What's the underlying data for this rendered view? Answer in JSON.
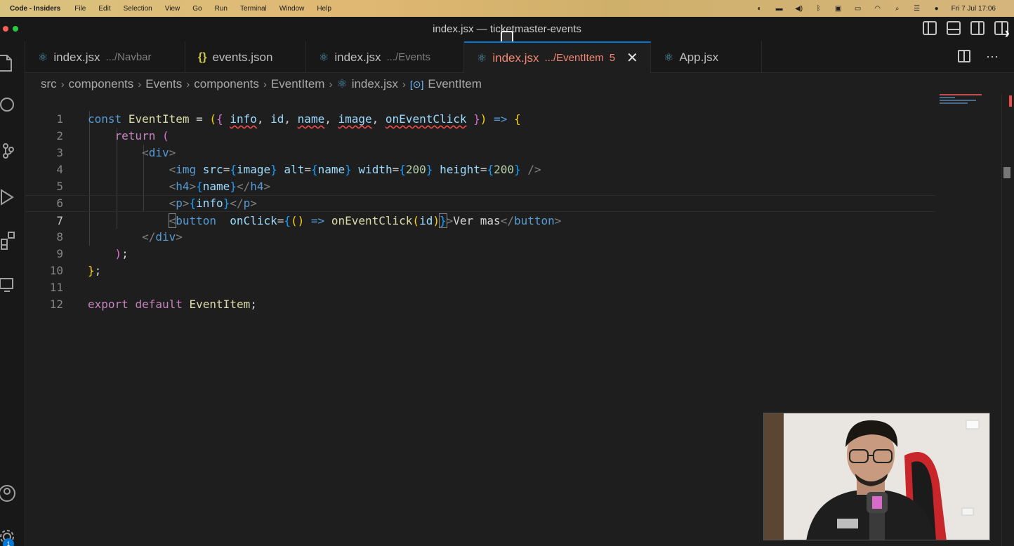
{
  "menubar": {
    "app_name": "Code - Insiders",
    "items": [
      "File",
      "Edit",
      "Selection",
      "View",
      "Go",
      "Run",
      "Terminal",
      "Window",
      "Help"
    ],
    "clock": "Fri 7 Jul  17:06"
  },
  "window": {
    "title": "index.jsx — ticketmaster-events"
  },
  "tabs": [
    {
      "name": "index.jsx",
      "path": ".../Navbar",
      "icon": "react-icon"
    },
    {
      "name": "events.json",
      "path": "",
      "icon": "json-icon"
    },
    {
      "name": "index.jsx",
      "path": ".../Events",
      "icon": "react-icon"
    },
    {
      "name": "index.jsx",
      "path": ".../EventItem",
      "problems": "5",
      "icon": "react-icon",
      "active": true
    },
    {
      "name": "App.jsx",
      "path": "",
      "icon": "react-icon"
    }
  ],
  "breadcrumb": [
    "src",
    "components",
    "Events",
    "components",
    "EventItem",
    "index.jsx",
    "EventItem"
  ],
  "editor": {
    "current_line": 7,
    "line_numbers": [
      "1",
      "2",
      "3",
      "4",
      "5",
      "6",
      "7",
      "8",
      "9",
      "10",
      "11",
      "12"
    ]
  },
  "colors": {
    "accent": "#0078d4",
    "error": "#f14c4c",
    "modified_tab": "#f48771"
  },
  "activity_icons": [
    "explorer-icon",
    "search-icon",
    "source-control-icon",
    "run-debug-icon",
    "extensions-icon",
    "remote-explorer-icon",
    "account-icon",
    "settings-gear-icon"
  ],
  "settings_badge": "1"
}
